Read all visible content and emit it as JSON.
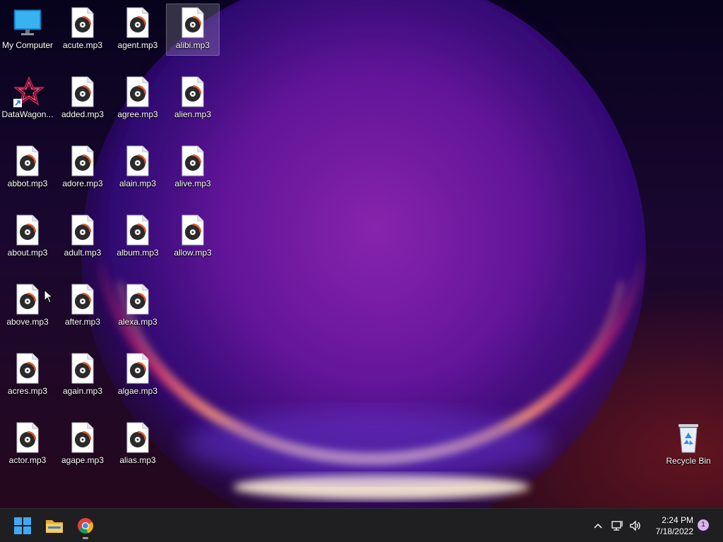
{
  "desktop": {
    "icons": [
      {
        "label": "My Computer",
        "type": "computer-icon"
      },
      {
        "label": "acute.mp3",
        "type": "audio-file-icon"
      },
      {
        "label": "agent.mp3",
        "type": "audio-file-icon"
      },
      {
        "label": "alibi.mp3",
        "type": "audio-file-icon",
        "selected": true
      },
      {
        "label": "DataWagon...",
        "type": "app-shortcut-icon"
      },
      {
        "label": "added.mp3",
        "type": "audio-file-icon"
      },
      {
        "label": "agree.mp3",
        "type": "audio-file-icon"
      },
      {
        "label": "alien.mp3",
        "type": "audio-file-icon"
      },
      {
        "label": "abbot.mp3",
        "type": "audio-file-icon"
      },
      {
        "label": "adore.mp3",
        "type": "audio-file-icon"
      },
      {
        "label": "alain.mp3",
        "type": "audio-file-icon"
      },
      {
        "label": "alive.mp3",
        "type": "audio-file-icon"
      },
      {
        "label": "about.mp3",
        "type": "audio-file-icon"
      },
      {
        "label": "adult.mp3",
        "type": "audio-file-icon"
      },
      {
        "label": "album.mp3",
        "type": "audio-file-icon"
      },
      {
        "label": "allow.mp3",
        "type": "audio-file-icon"
      },
      {
        "label": "above.mp3",
        "type": "audio-file-icon"
      },
      {
        "label": "after.mp3",
        "type": "audio-file-icon"
      },
      {
        "label": "alexa.mp3",
        "type": "audio-file-icon"
      },
      {
        "label": "acres.mp3",
        "type": "audio-file-icon"
      },
      {
        "label": "again.mp3",
        "type": "audio-file-icon"
      },
      {
        "label": "algae.mp3",
        "type": "audio-file-icon"
      },
      {
        "label": "actor.mp3",
        "type": "audio-file-icon"
      },
      {
        "label": "agape.mp3",
        "type": "audio-file-icon"
      },
      {
        "label": "alias.mp3",
        "type": "audio-file-icon"
      }
    ],
    "recycle_bin": {
      "label": "Recycle Bin",
      "type": "recycle-bin-icon"
    }
  },
  "taskbar": {
    "apps": [
      {
        "name": "start",
        "icon": "windows-logo-icon"
      },
      {
        "name": "file-explorer",
        "icon": "folder-icon"
      },
      {
        "name": "chrome",
        "icon": "chrome-icon",
        "running": true
      }
    ],
    "tray": {
      "icons": [
        "chevron-up-icon",
        "network-icon",
        "speaker-icon"
      ],
      "time": "2:24 PM",
      "date": "7/18/2022",
      "notification_count": "1"
    }
  },
  "colors": {
    "taskbar": "#1f1f22",
    "accent_blue": "#3fa9f5",
    "folder": "#f0c14b",
    "badge": "#d9b3f0"
  }
}
